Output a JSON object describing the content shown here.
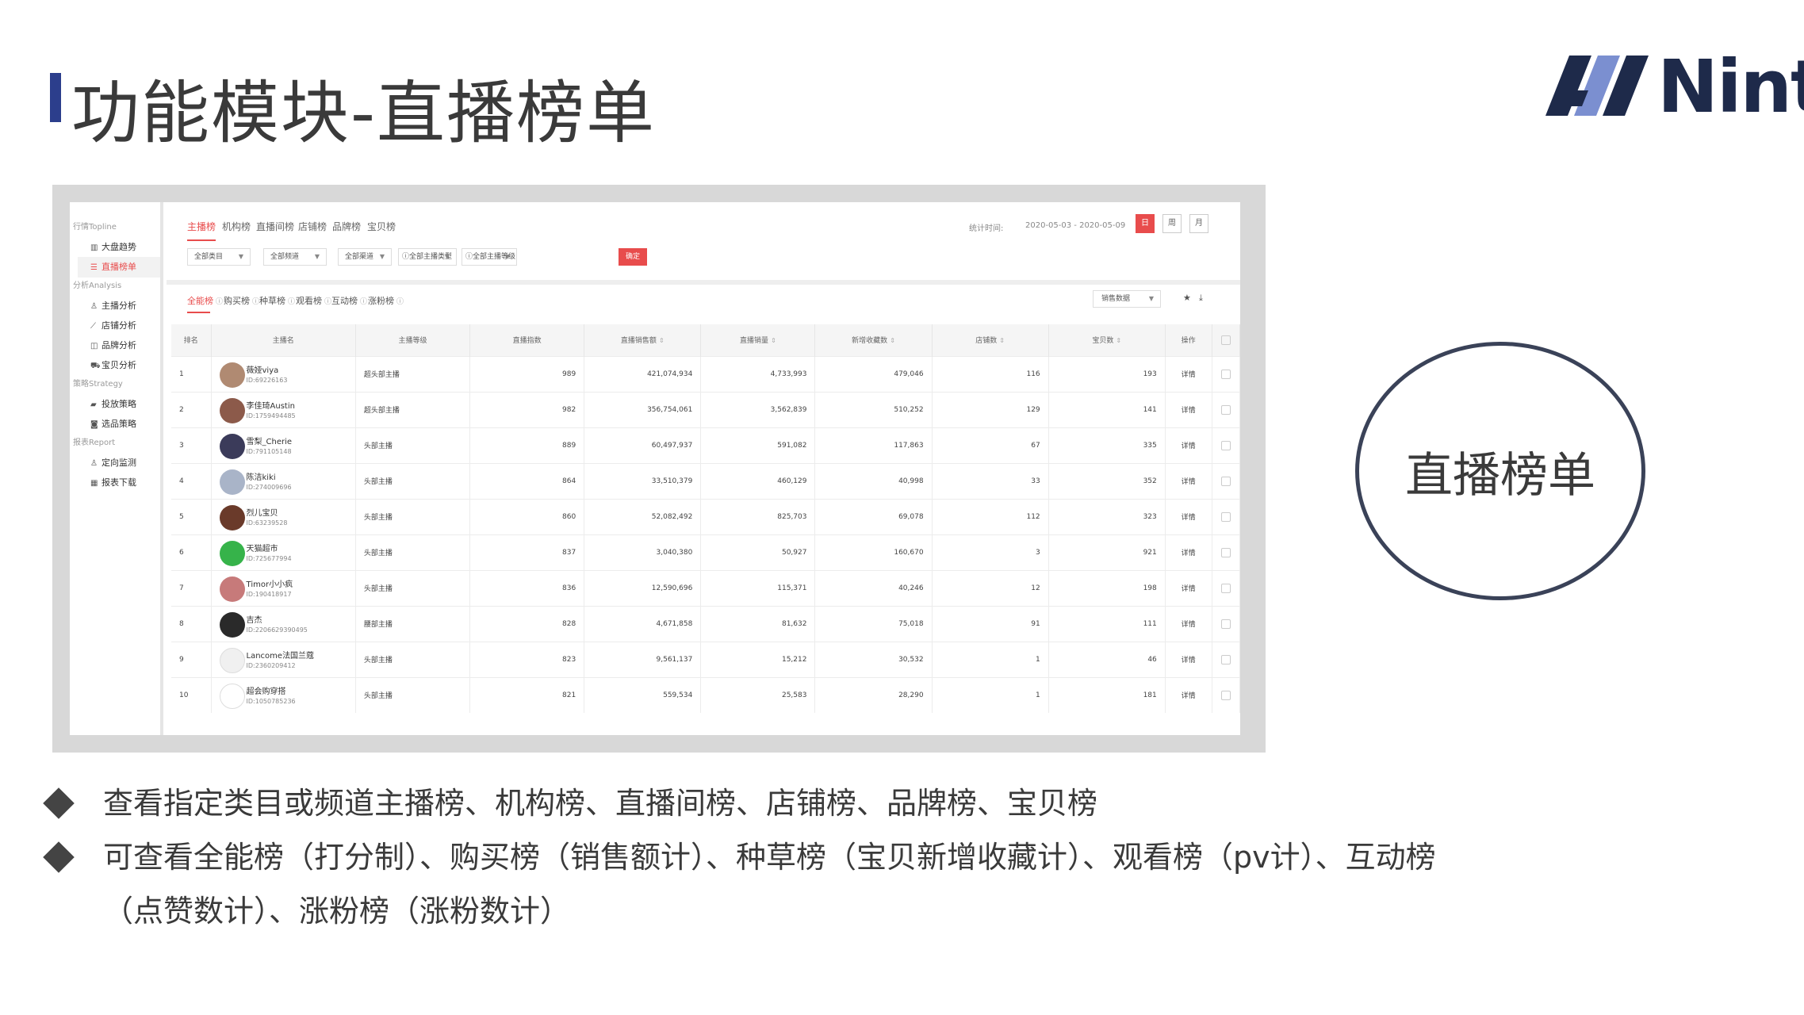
{
  "slide": {
    "title": "功能模块-直播榜单",
    "logo_text": "Nint",
    "circle_label": "直播榜单",
    "bullets": [
      "查看指定类目或频道主播榜、机构榜、直播间榜、店铺榜、品牌榜、宝贝榜",
      "可查看全能榜（打分制）、购买榜（销售额计）、种草榜（宝贝新增收藏计）、观看榜（pv计）、互动榜",
      "（点赞数计）、涨粉榜（涨粉数计）"
    ],
    "colors": {
      "accent_red": "#e84c4c",
      "title_bar": "#2c3e8c",
      "logo_dark": "#1e2a4a",
      "logo_blue": "#7b8fd0"
    }
  },
  "app": {
    "sidebar": {
      "groups": [
        {
          "label": "行情Topline",
          "items": [
            {
              "label": "大盘趋势",
              "icon": "bar-chart-icon"
            },
            {
              "label": "直播榜单",
              "icon": "list-icon",
              "active": true
            }
          ]
        },
        {
          "label": "分析Analysis",
          "items": [
            {
              "label": "主播分析",
              "icon": "user-icon"
            },
            {
              "label": "店铺分析",
              "icon": "line-chart-icon"
            },
            {
              "label": "品牌分析",
              "icon": "brand-icon"
            },
            {
              "label": "宝贝分析",
              "icon": "cart-icon"
            }
          ]
        },
        {
          "label": "策略Strategy",
          "items": [
            {
              "label": "投放策略",
              "icon": "book-icon"
            },
            {
              "label": "选品策略",
              "icon": "camera-icon"
            }
          ]
        },
        {
          "label": "报表Report",
          "items": [
            {
              "label": "定向监测",
              "icon": "user-icon"
            },
            {
              "label": "报表下载",
              "icon": "table-icon"
            }
          ]
        }
      ]
    },
    "top_tabs": [
      "主播榜",
      "机构榜",
      "直播间榜",
      "店铺榜",
      "品牌榜",
      "宝贝榜"
    ],
    "date_label": "统计时间:",
    "date_range": "2020-05-03 - 2020-05-09",
    "periods": [
      "日",
      "周",
      "月"
    ],
    "filters": [
      "全部类目",
      "全部频道",
      "全部渠道",
      "全部主播类型",
      "全部主播等级"
    ],
    "confirm_label": "确定",
    "sub_tabs": [
      "全能榜",
      "购买榜",
      "种草榜",
      "观看榜",
      "互动榜",
      "涨粉榜"
    ],
    "metric_select": "销售数据",
    "table": {
      "headers": [
        "排名",
        "主播名",
        "主播等级",
        "直播指数",
        "直播销售额",
        "直播销量",
        "新增收藏数",
        "店铺数",
        "宝贝数",
        "操作"
      ],
      "detail_label": "详情",
      "rows": [
        {
          "rank": "1",
          "name": "薇娅viya",
          "id": "ID:69226163",
          "level": "超头部主播",
          "index": "989",
          "sales": "421,074,934",
          "volume": "4,733,993",
          "fav": "479,046",
          "shops": "116",
          "items": "193",
          "avatar": "#b08a72"
        },
        {
          "rank": "2",
          "name": "李佳琦Austin",
          "id": "ID:1759494485",
          "level": "超头部主播",
          "index": "982",
          "sales": "356,754,061",
          "volume": "3,562,839",
          "fav": "510,252",
          "shops": "129",
          "items": "141",
          "avatar": "#8c5a4a"
        },
        {
          "rank": "3",
          "name": "雪梨_Cherie",
          "id": "ID:791105148",
          "level": "头部主播",
          "index": "889",
          "sales": "60,497,937",
          "volume": "591,082",
          "fav": "117,863",
          "shops": "67",
          "items": "335",
          "avatar": "#3b3b5a"
        },
        {
          "rank": "4",
          "name": "陈洁kiki",
          "id": "ID:274009696",
          "level": "头部主播",
          "index": "864",
          "sales": "33,510,379",
          "volume": "460,129",
          "fav": "40,998",
          "shops": "33",
          "items": "352",
          "avatar": "#a9b4c8"
        },
        {
          "rank": "5",
          "name": "烈儿宝贝",
          "id": "ID:63239528",
          "level": "头部主播",
          "index": "860",
          "sales": "52,082,492",
          "volume": "825,703",
          "fav": "69,078",
          "shops": "112",
          "items": "323",
          "avatar": "#6a3a2a"
        },
        {
          "rank": "6",
          "name": "天猫超市",
          "id": "ID:725677994",
          "level": "头部主播",
          "index": "837",
          "sales": "3,040,380",
          "volume": "50,927",
          "fav": "160,670",
          "shops": "3",
          "items": "921",
          "avatar": "#36b34a"
        },
        {
          "rank": "7",
          "name": "Timor小小疯",
          "id": "ID:190418917",
          "level": "头部主播",
          "index": "836",
          "sales": "12,590,696",
          "volume": "115,371",
          "fav": "40,246",
          "shops": "12",
          "items": "198",
          "avatar": "#c77a7a"
        },
        {
          "rank": "8",
          "name": "吉杰",
          "id": "ID:2206629390495",
          "level": "腰部主播",
          "index": "828",
          "sales": "4,671,858",
          "volume": "81,632",
          "fav": "75,018",
          "shops": "91",
          "items": "111",
          "avatar": "#2a2a2a"
        },
        {
          "rank": "9",
          "name": "Lancome法国兰蔻",
          "id": "ID:2360209412",
          "level": "头部主播",
          "index": "823",
          "sales": "9,561,137",
          "volume": "15,212",
          "fav": "30,532",
          "shops": "1",
          "items": "46",
          "avatar": "#f0f0f0"
        },
        {
          "rank": "10",
          "name": "超会购穿搭",
          "id": "ID:1050785236",
          "level": "头部主播",
          "index": "821",
          "sales": "559,534",
          "volume": "25,583",
          "fav": "28,290",
          "shops": "1",
          "items": "181",
          "avatar": "#ffffff"
        }
      ]
    }
  }
}
